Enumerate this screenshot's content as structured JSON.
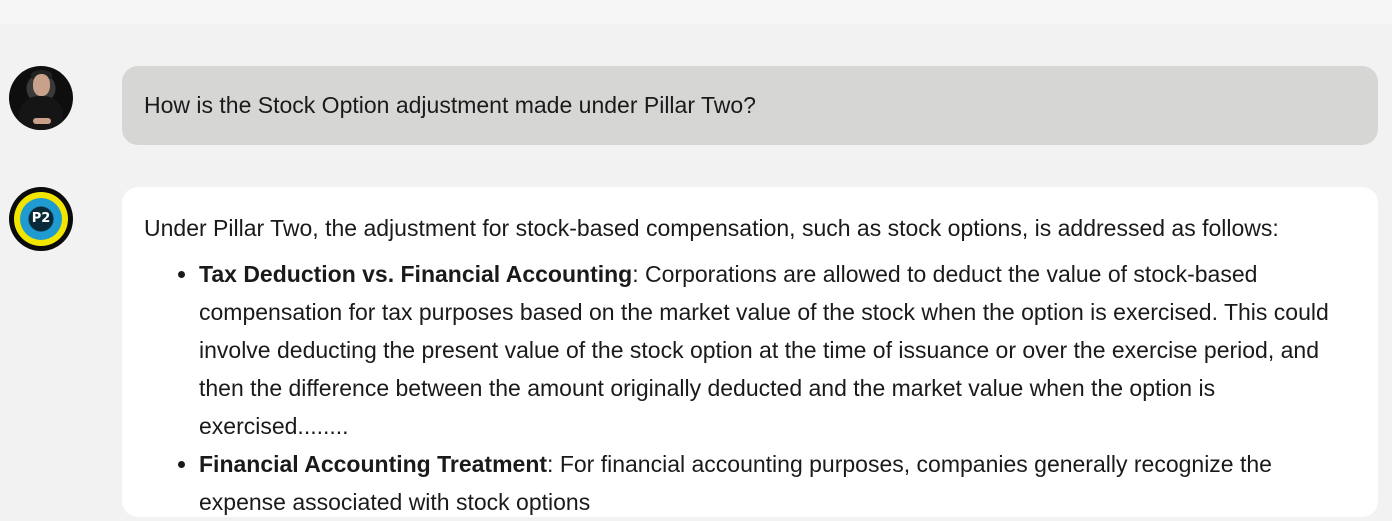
{
  "user": {
    "avatar_icon": "user-avatar-photo",
    "message": "How is the Stock Option adjustment made under Pillar Two?"
  },
  "assistant": {
    "avatar_label": "P2",
    "intro": "Under Pillar Two, the adjustment for stock-based compensation, such as stock options, is addressed as follows:",
    "bullets": [
      {
        "term": "Tax Deduction vs. Financial Accounting",
        "text": ": Corporations are allowed to deduct the value of stock-based compensation for tax purposes based on the market value of the stock when the option is exercised. This could involve deducting the present value of the stock option at the time of issuance or over the exercise period, and then the difference between the amount originally deducted and the market value when the option is exercised........"
      },
      {
        "term": "Financial Accounting Treatment",
        "text": ": For financial accounting purposes, companies generally recognize the expense associated with stock options"
      }
    ]
  },
  "colors": {
    "page_bg": "#f2f2f2",
    "user_bubble": "#d6d7d5",
    "assistant_bubble": "#ffffff",
    "badge_ring": "#f2e600",
    "badge_inner": "#1f9bd1"
  }
}
